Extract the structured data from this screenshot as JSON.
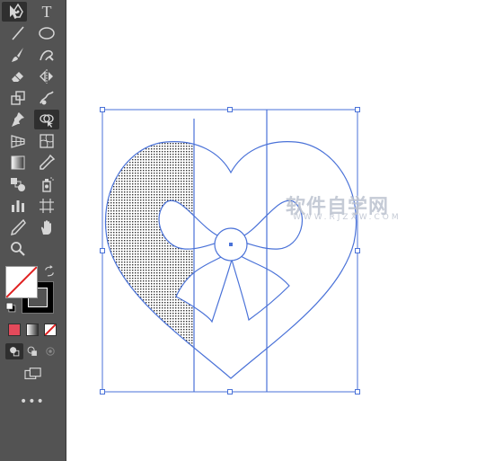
{
  "toolbar": {
    "type_tool_glyph": "T",
    "more_tools_glyph": "•••",
    "fill_swatch": {
      "type": "none"
    },
    "stroke_swatch": {
      "color": "#000000"
    }
  },
  "icons": [
    "selection-arrow-icon",
    "pen-icon",
    "type-icon",
    "line-segment-icon",
    "ellipse-icon",
    "paintbrush-icon",
    "shaper-icon",
    "eraser-icon",
    "reflect-icon",
    "scale-icon",
    "warp-icon",
    "pin-icon",
    "shape-builder-icon",
    "perspective-grid-icon",
    "mesh-icon",
    "gradient-icon",
    "eyedropper-icon",
    "blend-icon",
    "symbol-sprayer-icon",
    "column-graph-icon",
    "artboard-icon",
    "slice-icon",
    "hand-icon",
    "zoom-icon",
    "swap-fill-stroke-icon",
    "default-colors-icon",
    "color-mode-icon",
    "gradient-mode-icon",
    "none-mode-icon",
    "draw-normal-icon",
    "draw-behind-icon",
    "draw-inside-icon",
    "screen-mode-icon"
  ],
  "colors": {
    "toolbar_bg": "#535353",
    "selection_blue": "#4a72d8",
    "active_tool_bg": "#2f2f2f",
    "none_slash_red": "#e02020",
    "color_mode_swatch": "#e44a5b"
  },
  "watermark": {
    "text": "软件自学网",
    "subtext": "WWW.RJZXW.COM"
  }
}
